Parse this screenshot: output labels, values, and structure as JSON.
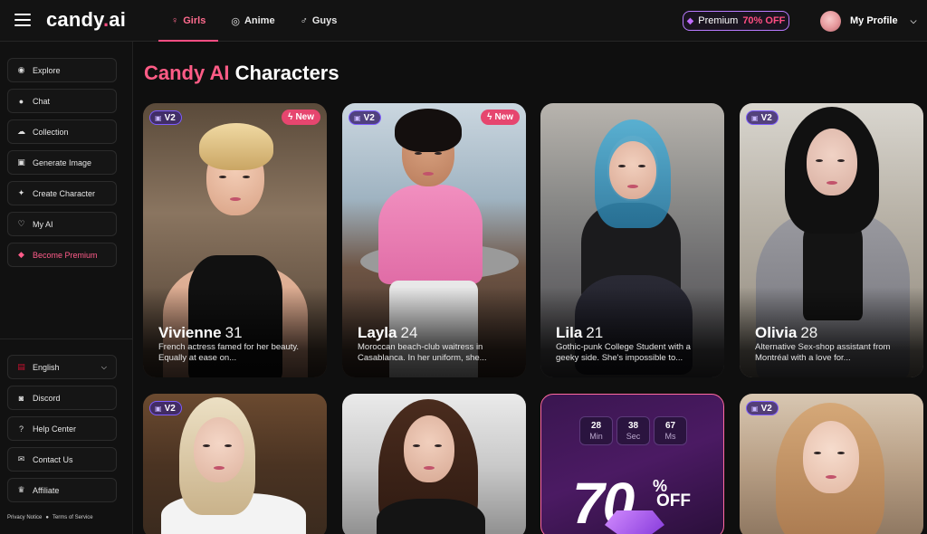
{
  "header": {
    "logo_main": "candy",
    "logo_dot": ".",
    "logo_ai": "ai",
    "tabs": [
      {
        "label": "Girls",
        "icon": "female-icon",
        "active": true
      },
      {
        "label": "Anime",
        "icon": "anime-swirl-icon",
        "active": false
      },
      {
        "label": "Guys",
        "icon": "male-icon",
        "active": false
      }
    ],
    "premium_label": "Premium",
    "premium_discount": "70% OFF",
    "profile_label": "My Profile"
  },
  "sidebar": {
    "items": [
      {
        "label": "Explore",
        "icon": "compass-icon"
      },
      {
        "label": "Chat",
        "icon": "chat-bubble-icon"
      },
      {
        "label": "Collection",
        "icon": "collection-icon"
      },
      {
        "label": "Generate Image",
        "icon": "image-icon"
      },
      {
        "label": "Create Character",
        "icon": "magic-wand-icon"
      },
      {
        "label": "My AI",
        "icon": "heart-icon"
      },
      {
        "label": "Become Premium",
        "icon": "diamond-icon"
      }
    ],
    "bottom": [
      {
        "label": "English",
        "icon": "us-flag-icon"
      },
      {
        "label": "Discord",
        "icon": "discord-icon"
      },
      {
        "label": "Help Center",
        "icon": "help-icon"
      },
      {
        "label": "Contact Us",
        "icon": "handshake-icon"
      },
      {
        "label": "Affiliate",
        "icon": "trophy-icon"
      }
    ],
    "privacy": "Privacy Notice",
    "terms": "Terms of Service"
  },
  "main": {
    "title_highlight": "Candy AI",
    "title_rest": " Characters",
    "badge_v2": "V2",
    "badge_new": "New",
    "cards": [
      {
        "name": "Vivienne",
        "age": "31",
        "desc": "French actress famed for her beauty. Equally at ease on...",
        "v2": true,
        "new": true
      },
      {
        "name": "Layla",
        "age": "24",
        "desc": "Moroccan beach-club waitress in Casablanca. In her uniform, she...",
        "v2": true,
        "new": true
      },
      {
        "name": "Lila",
        "age": "21",
        "desc": "Gothic-punk College Student with a geeky side. She's impossible to...",
        "v2": false,
        "new": false
      },
      {
        "name": "Olivia",
        "age": "28",
        "desc": "Alternative Sex-shop assistant from Montréal with a love for...",
        "v2": true,
        "new": false
      }
    ],
    "row2_v2": "V2",
    "promo": {
      "countdown": [
        {
          "num": "28",
          "label": "Min"
        },
        {
          "num": "38",
          "label": "Sec"
        },
        {
          "num": "67",
          "label": "Ms"
        }
      ],
      "big": "70",
      "pct": "%",
      "off": "OFF"
    }
  },
  "colors": {
    "accent": "#ff4e82",
    "premium_border": "#b97bff",
    "background": "#0f0f0f"
  }
}
